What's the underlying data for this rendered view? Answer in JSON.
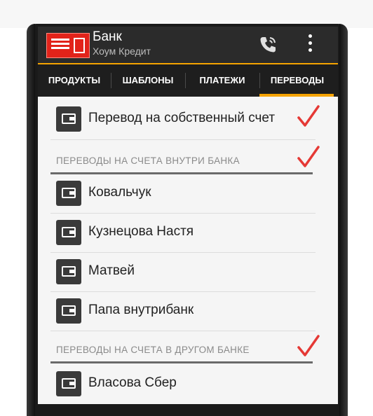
{
  "app": {
    "title": "Банк",
    "subtitle": "Хоум Кредит",
    "logo_icon": "home-credit-logo",
    "accent_color": "#f5a300",
    "brand_color": "#e2231a"
  },
  "actions": {
    "call_icon": "phone-icon",
    "menu_icon": "overflow-menu-icon"
  },
  "tabs": [
    {
      "label": "ПРОДУКТЫ",
      "selected": false
    },
    {
      "label": "ШАБЛОНЫ",
      "selected": false
    },
    {
      "label": "ПЛАТЕЖИ",
      "selected": false
    },
    {
      "label": "ПЕРЕВОДЫ",
      "selected": true
    }
  ],
  "own_transfer": {
    "label": "Перевод на собственный счет",
    "icon": "wallet-icon"
  },
  "sections": [
    {
      "title": "ПЕРЕВОДЫ НА СЧЕТА ВНУТРИ БАНКА",
      "items": [
        {
          "label": "Ковальчук",
          "icon": "wallet-icon"
        },
        {
          "label": "Кузнецова Настя",
          "icon": "wallet-icon"
        },
        {
          "label": "Матвей",
          "icon": "wallet-icon"
        },
        {
          "label": "Папа внутрибанк",
          "icon": "wallet-icon"
        }
      ]
    },
    {
      "title": "ПЕРЕВОДЫ НА СЧЕТА В ДРУГОМ БАНКЕ",
      "items": [
        {
          "label": "Власова Сбер",
          "icon": "wallet-icon"
        }
      ]
    }
  ],
  "annotation": {
    "checkmark_color": "#e53935",
    "checkmark_icon": "checkmark-icon"
  }
}
